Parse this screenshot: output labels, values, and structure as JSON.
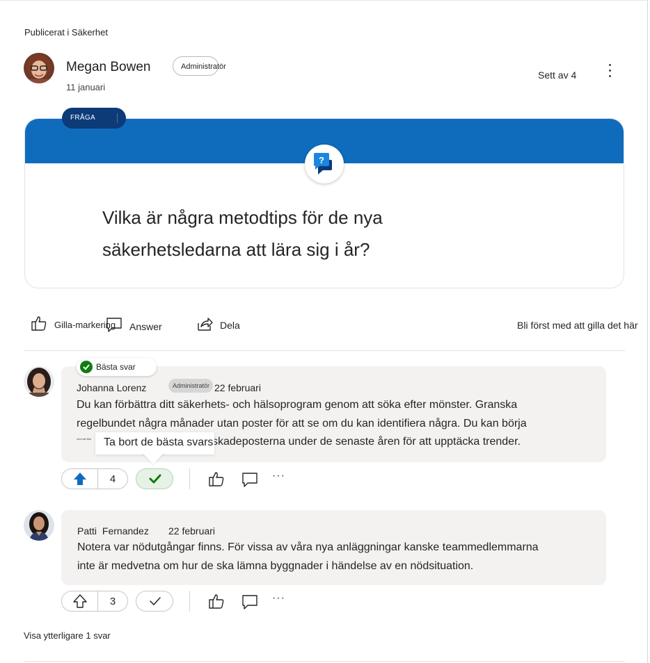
{
  "post": {
    "posted_in": "Publicerat i Säkerhet",
    "author_name": "Megan Bowen",
    "author_role": "Administratör",
    "date": "11 januari",
    "seen_by": "Sett av 4",
    "tag": "FRÅGA",
    "question_line1": "Vilka är några metodtips för de nya",
    "question_line2": "säkerhetsledarna att lära sig i år?"
  },
  "actions": {
    "like": "Gilla-markering",
    "answer": "Answer",
    "share": "Dela",
    "like_prompt": "Bli först med att gilla det här"
  },
  "answers": [
    {
      "badge": "Bästa svar",
      "name": "Johanna Lorenz",
      "role": "Administratör",
      "date": "22 februari",
      "line1": "Du kan förbättra ditt säkerhets- och hälsoprogram genom att söka efter mönster. Granska",
      "line2": "regelbundet några månader utan poster för att se om du kan identifiera några. Du kan börja",
      "line3_hidden": "med att titta",
      "line3": "skadeposterna under de senaste åren för att upptäcka trender.",
      "votes": "4",
      "tooltip": "Ta bort de bästa svars",
      "more": "···"
    },
    {
      "name_first": "Patti",
      "name_last": "Fernandez",
      "date": "22 februari",
      "line1": "Notera var nödutgångar finns. För vissa av våra nya anläggningar kanske teammedlemmarna",
      "line2": "inte är medvetna om hur de ska lämna byggnader i händelse av en nödsituation.",
      "votes": "3",
      "more": "···"
    }
  ],
  "show_more": "Visa ytterligare 1 svar",
  "colors": {
    "brand_blue": "#0f6cbd",
    "tag_navy": "#0c3b78",
    "accept_green": "#107c10",
    "bubble_bg": "#f3f2f1"
  }
}
